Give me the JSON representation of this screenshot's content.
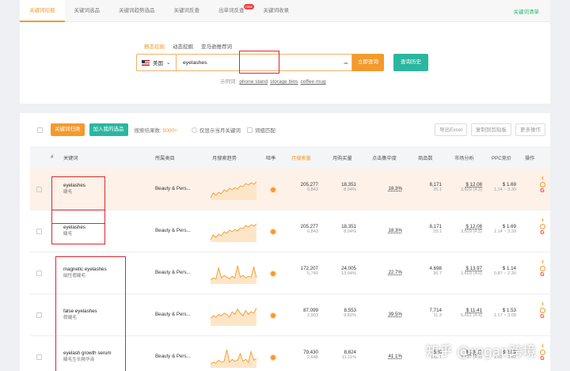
{
  "tabs": [
    {
      "label": "关键词挖掘",
      "active": true
    },
    {
      "label": "关键词选品"
    },
    {
      "label": "关键词趋势选品"
    },
    {
      "label": "关键词反查"
    },
    {
      "label": "出单词反查",
      "badge": "new"
    },
    {
      "label": "关键词收录"
    }
  ],
  "tab_right": "关键词清单",
  "subtabs": [
    {
      "label": "静态挖掘",
      "active": true
    },
    {
      "label": "动态挖掘"
    },
    {
      "label": "亚马逊推荐词"
    }
  ],
  "search": {
    "country": "美国",
    "value": "eyelashes",
    "search_btn": "立即查询",
    "history_btn": "查询历史"
  },
  "examples": {
    "label": "示例词:",
    "words": [
      "phone stand",
      "storage bins",
      "coffee mug"
    ]
  },
  "toolbar": {
    "btn1": "关键词归类",
    "btn2": "加入我的选品",
    "count_label": "搜索结果数:",
    "count_value": "5000+",
    "opt1": "仅显示当月关键词",
    "opt2": "词组匹配",
    "export": "导出Excel",
    "copy": "复制到剪贴板",
    "more": "更多操作"
  },
  "columns": {
    "index": "#",
    "keyword": "关键词",
    "category": "所属类目",
    "trend": "月搜索趋势",
    "rank": "旺季",
    "monthly_search": "月搜索量",
    "purchases": "月购买量",
    "click_share": "点击集中度",
    "products": "商品数",
    "market": "市场分析",
    "ppc": "PPC竞价",
    "ops": "操作"
  },
  "rows": [
    {
      "kw": "eyelashes",
      "cn": "睫毛",
      "cat": "Beauty & Pers...",
      "search": "205,277",
      "search_sub": "6,843",
      "buy": "18,351",
      "buy_sub": "8.94%",
      "click": "18.3%",
      "prod": "8,171",
      "prod_sub": "25.1",
      "price": "$ 12.08",
      "price_sub": "3,829 (4.3)",
      "ppc": "$ 1.69",
      "ppc_sub": "1.14 ~ 3.39",
      "highlight": true
    },
    {
      "kw": "eyelashes",
      "cn": "睫毛",
      "cat": "Beauty & Pers...",
      "search": "205,277",
      "search_sub": "6,843",
      "buy": "18,351",
      "buy_sub": "8.94%",
      "click": "18.3%",
      "prod": "8,171",
      "prod_sub": "25.1",
      "price": "$ 12.08",
      "price_sub": "3,829 (4.3)",
      "ppc": "$ 1.69",
      "ppc_sub": "1.14 ~ 3.39"
    },
    {
      "kw": "magnetic eyelashes",
      "cn": "磁性假睫毛",
      "cat": "Beauty & Pers...",
      "search": "172,207",
      "search_sub": "5,740",
      "buy": "24,005",
      "buy_sub": "13.94%",
      "click": "22.7%",
      "prod": "4,698",
      "prod_sub": "36.7",
      "price": "$ 13.97",
      "price_sub": "1,603 (4.0)",
      "ppc": "$ 1.14",
      "ppc_sub": "0.87 ~ 2.30"
    },
    {
      "kw": "false eyelashes",
      "cn": "假睫毛",
      "cat": "Beauty & Pers...",
      "search": "87,099",
      "search_sub": "2,903",
      "buy": "8,553",
      "buy_sub": "9.82%",
      "click": "39.5%",
      "prod": "7,714",
      "prod_sub": "11.3",
      "price": "$ 11.41",
      "price_sub": "5,661 (4.4)",
      "ppc": "$ 1.53",
      "ppc_sub": "1.17 ~ 3.08"
    },
    {
      "kw": "eyelash growth serum",
      "cn": "睫毛生长精华液",
      "cat": "Beauty & Pers...",
      "search": "79,430",
      "search_sub": "2,648",
      "buy": "8,824",
      "buy_sub": "11.11%",
      "click": "41.1%",
      "prod": "526",
      "prod_sub": "151.1",
      "price": "$ 23.97",
      "price_sub": "3,437 (4.3)",
      "ppc": "$ 2.09",
      "ppc_sub": "1.02 ~ 3.82"
    }
  ],
  "watermark": "知乎 @regan跨境"
}
